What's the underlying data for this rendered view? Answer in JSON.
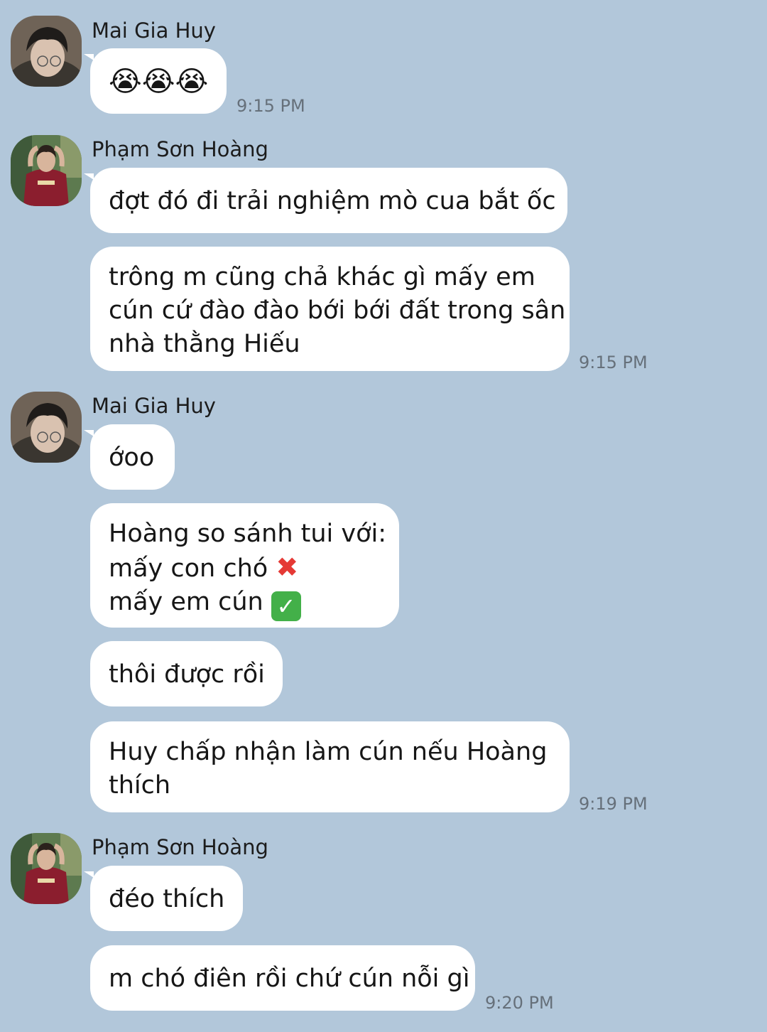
{
  "conversation": {
    "background": "#b2c7da",
    "groups": [
      {
        "sender": "Mai Gia Huy",
        "avatar": "avatar-mai-gia-huy",
        "messages": [
          {
            "emoji": [
              "loudly-crying-face",
              "loudly-crying-face",
              "loudly-crying-face"
            ],
            "text": "😭😭😭"
          }
        ],
        "time": "9:15 PM"
      },
      {
        "sender": "Phạm Sơn Hoàng",
        "avatar": "avatar-pham-son-hoang",
        "messages": [
          {
            "lines": [
              "đợt đó đi trải nghiệm mò cua bắt ốc"
            ]
          },
          {
            "lines": [
              "trông m cũng chả khác gì mấy em",
              "cún cứ đào đào bới bới đất trong sân",
              "nhà thằng Hiếu"
            ]
          }
        ],
        "time": "9:15 PM"
      },
      {
        "sender": "Mai Gia Huy",
        "avatar": "avatar-mai-gia-huy",
        "messages": [
          {
            "lines": [
              "ớoo"
            ]
          },
          {
            "lines": [
              "Hoàng so sánh tui với:",
              "mấy con chó",
              "mấy em cún"
            ],
            "line_icons": [
              "",
              "cross-mark-icon",
              "check-mark-icon"
            ]
          },
          {
            "lines": [
              "thôi được rồi"
            ]
          },
          {
            "lines": [
              "Huy chấp nhận làm cún nếu Hoàng",
              "thích"
            ]
          }
        ],
        "time": "9:19 PM"
      },
      {
        "sender": "Phạm Sơn Hoàng",
        "avatar": "avatar-pham-son-hoang",
        "messages": [
          {
            "lines": [
              "đéo thích"
            ]
          },
          {
            "lines": [
              "m chó điên rồi chứ cún nỗi gì"
            ]
          }
        ],
        "time": "9:20 PM"
      }
    ]
  }
}
